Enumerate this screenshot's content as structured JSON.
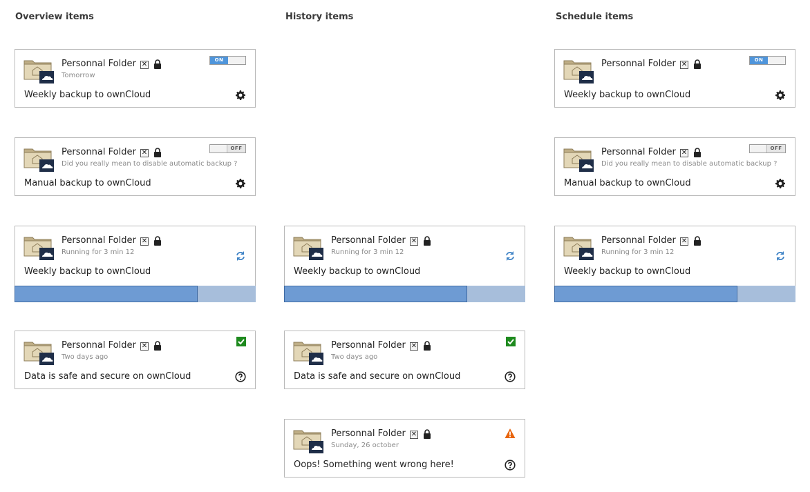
{
  "columns": {
    "overview": "Overview items",
    "history": "History items",
    "schedule": "Schedule items"
  },
  "folder_name": "Personnal Folder",
  "close_glyph": "✕",
  "toggle": {
    "on": "ON",
    "off": "OFF"
  },
  "cards": {
    "scheduled": {
      "sub": "Tomorrow",
      "desc": "Weekly backup to ownCloud",
      "toggle_state": "on"
    },
    "manual": {
      "sub": "Did you really mean to disable automatic backup ?",
      "desc": "Manual backup to ownCloud",
      "toggle_state": "off"
    },
    "running": {
      "sub": "Running for 3 min 12",
      "desc": "Weekly backup to ownCloud",
      "progress": 0.76
    },
    "done": {
      "sub": "Two days ago",
      "desc": "Data is safe and secure on ownCloud"
    },
    "error": {
      "sub": "Sunday, 26 october",
      "desc": "Oops! Something went wrong here!"
    }
  },
  "colors": {
    "accent": "#4f95db",
    "progress": "#6e9bd3",
    "success": "#1e8a1e",
    "warning": "#e8640c"
  },
  "icons": [
    "folder-home-icon",
    "owncloud-icon",
    "close-icon",
    "lock-icon",
    "gear-icon",
    "sync-icon",
    "check-icon",
    "help-icon",
    "warning-icon"
  ]
}
